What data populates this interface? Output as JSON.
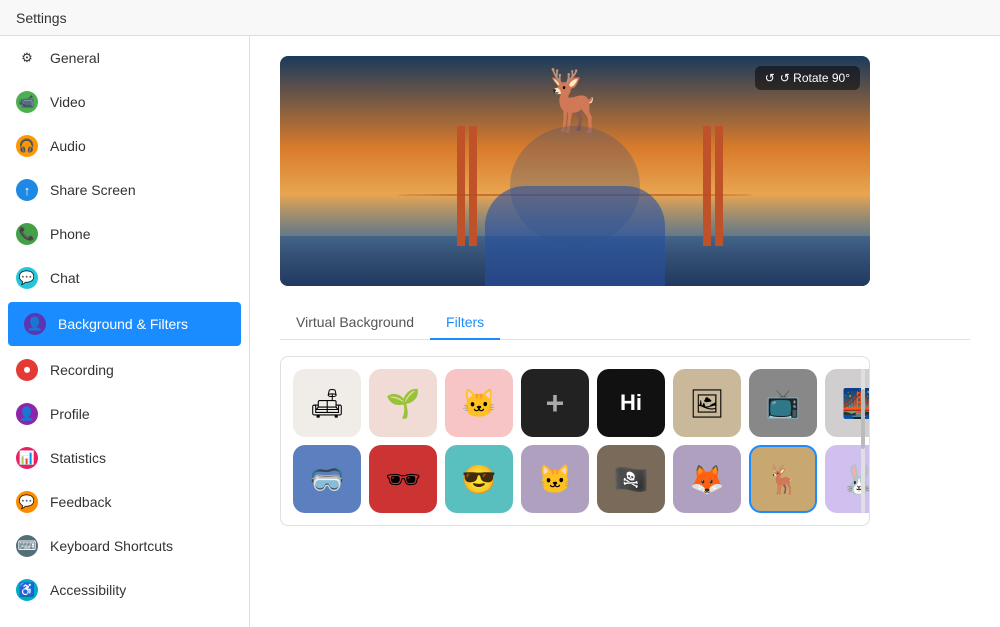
{
  "titleBar": {
    "label": "Settings"
  },
  "sidebar": {
    "items": [
      {
        "id": "general",
        "label": "General",
        "icon": "⚙",
        "iconClass": ""
      },
      {
        "id": "video",
        "label": "Video",
        "icon": "📹",
        "iconClass": "icon-green"
      },
      {
        "id": "audio",
        "label": "Audio",
        "icon": "🎧",
        "iconClass": "icon-orange"
      },
      {
        "id": "share-screen",
        "label": "Share Screen",
        "icon": "↑",
        "iconClass": "icon-blue-share"
      },
      {
        "id": "phone",
        "label": "Phone",
        "icon": "📞",
        "iconClass": "icon-green2"
      },
      {
        "id": "chat",
        "label": "Chat",
        "icon": "💬",
        "iconClass": "icon-chat"
      },
      {
        "id": "background-filters",
        "label": "Background & Filters",
        "icon": "👤",
        "iconClass": "icon-bg",
        "active": true
      },
      {
        "id": "recording",
        "label": "Recording",
        "icon": "⏺",
        "iconClass": "icon-rec"
      },
      {
        "id": "profile",
        "label": "Profile",
        "icon": "👤",
        "iconClass": "icon-profile"
      },
      {
        "id": "statistics",
        "label": "Statistics",
        "icon": "📊",
        "iconClass": "icon-stats"
      },
      {
        "id": "feedback",
        "label": "Feedback",
        "icon": "💬",
        "iconClass": "icon-feedback"
      },
      {
        "id": "keyboard-shortcuts",
        "label": "Keyboard Shortcuts",
        "icon": "⌨",
        "iconClass": "icon-keyboard"
      },
      {
        "id": "accessibility",
        "label": "Accessibility",
        "icon": "♿",
        "iconClass": "icon-access"
      }
    ]
  },
  "content": {
    "rotateButton": "↺ Rotate 90°",
    "tabs": [
      {
        "id": "virtual-background",
        "label": "Virtual Background"
      },
      {
        "id": "filters",
        "label": "Filters",
        "active": true
      }
    ],
    "filters": {
      "row1": [
        {
          "id": "none",
          "emoji": "🛋",
          "bgClass": "bg-none"
        },
        {
          "id": "plant",
          "emoji": "🌱",
          "bgClass": "bg-peach"
        },
        {
          "id": "pink",
          "emoji": "🐱",
          "bgClass": "bg-pink"
        },
        {
          "id": "add",
          "emoji": "+",
          "bgClass": "bg-dark"
        },
        {
          "id": "hi",
          "text": "Hi",
          "bgClass": "bg-black"
        },
        {
          "id": "portrait",
          "emoji": "🖼",
          "bgClass": "bg-tan"
        },
        {
          "id": "tv",
          "emoji": "📺",
          "bgClass": "bg-gray"
        },
        {
          "id": "city",
          "emoji": "🌉",
          "bgClass": "bg-light"
        }
      ],
      "row2": [
        {
          "id": "vr",
          "emoji": "🥽",
          "bgClass": "bg-blue"
        },
        {
          "id": "3d-glasses",
          "emoji": "👓",
          "bgClass": "bg-red"
        },
        {
          "id": "cool",
          "emoji": "😎",
          "bgClass": "bg-teal"
        },
        {
          "id": "cat2",
          "emoji": "🐱",
          "bgClass": "bg-cat"
        },
        {
          "id": "pirate",
          "emoji": "🏴‍☠️",
          "bgClass": "bg-pirate"
        },
        {
          "id": "fox",
          "emoji": "🦊",
          "bgClass": "bg-cat"
        },
        {
          "id": "deer",
          "emoji": "🦌",
          "bgClass": "bg-deer",
          "selected": true
        },
        {
          "id": "bunny",
          "emoji": "🐰",
          "bgClass": "bg-bunny"
        }
      ]
    }
  }
}
